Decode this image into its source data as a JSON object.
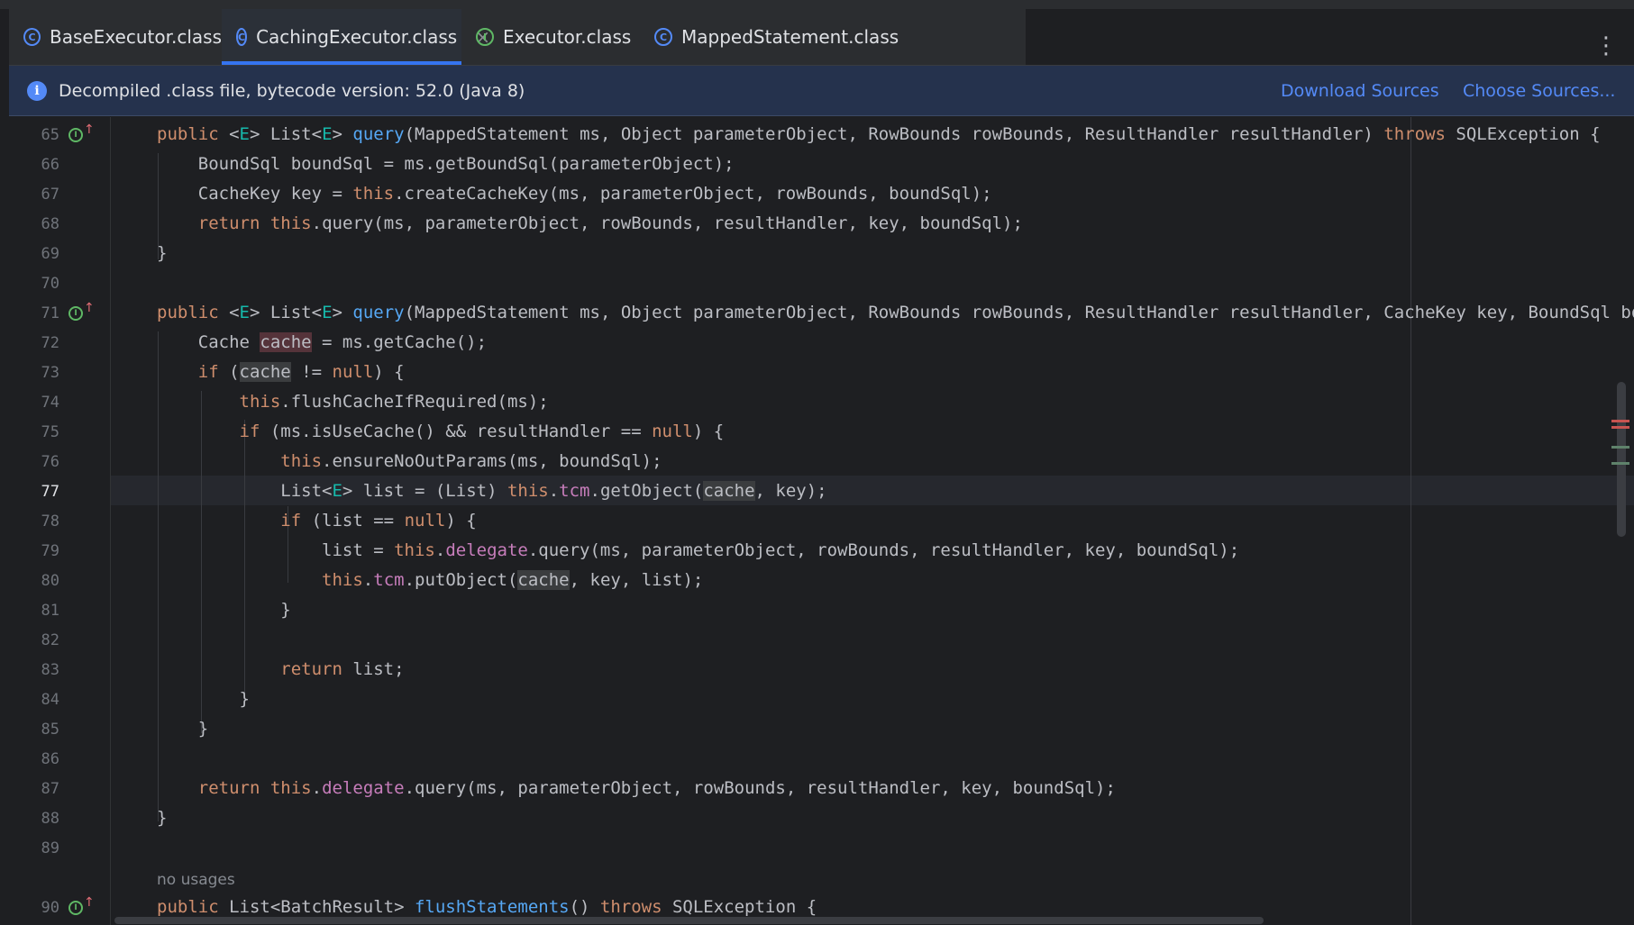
{
  "tabs": [
    {
      "label": "BaseExecutor.class",
      "icon": "class-icon",
      "active": false
    },
    {
      "label": "CachingExecutor.class",
      "icon": "class-icon",
      "active": true
    },
    {
      "label": "Executor.class",
      "icon": "interface-icon",
      "active": false
    },
    {
      "label": "MappedStatement.class",
      "icon": "class-icon",
      "active": false
    }
  ],
  "tab_close_glyph": "×",
  "more_glyph": "⋮",
  "banner": {
    "text": "Decompiled .class file, bytecode version: 52.0 (Java 8)",
    "download_sources": "Download Sources",
    "choose_sources": "Choose Sources..."
  },
  "editor": {
    "current_line": 77,
    "line_numbers": [
      "65",
      "66",
      "67",
      "68",
      "69",
      "70",
      "71",
      "72",
      "73",
      "74",
      "75",
      "76",
      "77",
      "78",
      "79",
      "80",
      "81",
      "82",
      "83",
      "84",
      "85",
      "86",
      "87",
      "88",
      "89",
      "90"
    ],
    "no_usages_hint": "no usages",
    "colors": {
      "keyword": "#cf8e6d",
      "method": "#56a8f5",
      "field": "#c77dbb",
      "type_param": "#16baac",
      "text": "#bcbec4"
    }
  }
}
